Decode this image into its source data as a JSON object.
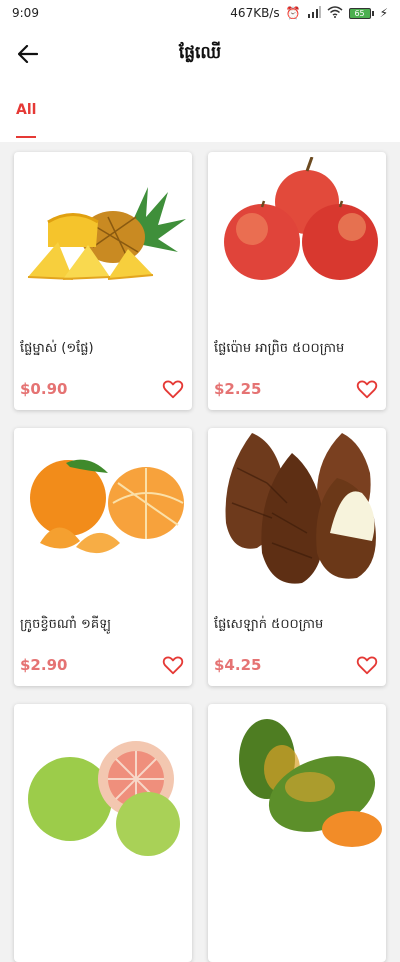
{
  "status": {
    "time": "9:09",
    "speed": "467KB/s",
    "battery": "65"
  },
  "header": {
    "title": "ផ្លែឈើ"
  },
  "tabs": [
    {
      "label": "All"
    }
  ],
  "products": [
    {
      "name": "ផ្លែម្នាស់ (១ផ្លែ)",
      "price": "$0.90",
      "icon": "pineapple-image"
    },
    {
      "name": "ផ្លែប៉ោម អាព្រិច ៥០០ក្រាម",
      "price": "$2.25",
      "icon": "apple-image"
    },
    {
      "name": "ក្រូចខ្វិចណាំ ១គីឡូ",
      "price": "$2.90",
      "icon": "tangerine-image"
    },
    {
      "name": "ផ្លែសេឡាក់ ៥០០ក្រាម",
      "price": "$4.25",
      "icon": "salak-image"
    },
    {
      "name": "",
      "price": "",
      "icon": "pomelo-image"
    },
    {
      "name": "",
      "price": "",
      "icon": "papaya-image"
    }
  ],
  "colors": {
    "accent": "#e53935",
    "price": "#e57373"
  }
}
